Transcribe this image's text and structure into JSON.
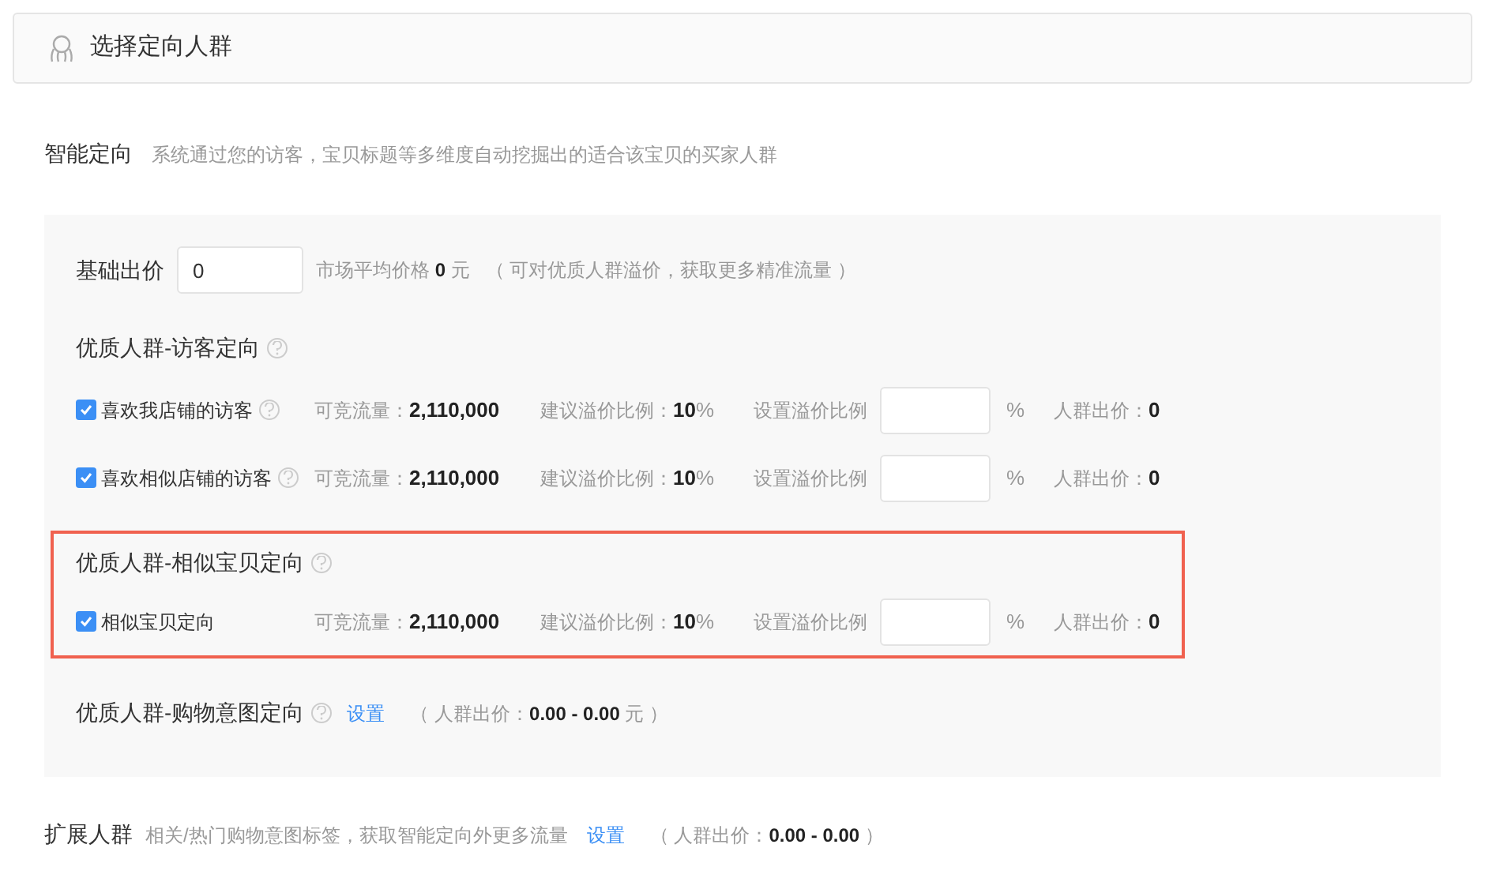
{
  "header": {
    "title": "选择定向人群"
  },
  "smart": {
    "title": "智能定向",
    "desc": "系统通过您的访客，宝贝标题等多维度自动挖掘出的适合该宝贝的买家人群"
  },
  "base_bid": {
    "label": "基础出价",
    "value": "0",
    "note": "市场平均价格 **0** 元",
    "hint": "（ 可对优质人群溢价，获取更多精准流量 ）"
  },
  "groups": [
    {
      "title": "优质人群-访客定向",
      "highlighted": false,
      "rows": [
        {
          "label": "喜欢我店铺的访客",
          "checked": true,
          "help": true,
          "traffic_label": "可竞流量：",
          "traffic": "2,110,000",
          "suggest_label": "建议溢价比例：",
          "suggest": "**10**%",
          "set_label": "设置溢价比例",
          "unit": "%",
          "bid_label": "人群出价：",
          "bid": "0"
        },
        {
          "label": "喜欢相似店铺的访客",
          "checked": true,
          "help": true,
          "traffic_label": "可竞流量：",
          "traffic": "2,110,000",
          "suggest_label": "建议溢价比例：",
          "suggest": "**10**%",
          "set_label": "设置溢价比例",
          "unit": "%",
          "bid_label": "人群出价：",
          "bid": "0"
        }
      ]
    },
    {
      "title": "优质人群-相似宝贝定向",
      "highlighted": true,
      "rows": [
        {
          "label": "相似宝贝定向",
          "checked": true,
          "help": false,
          "traffic_label": "可竞流量：",
          "traffic": "2,110,000",
          "suggest_label": "建议溢价比例：",
          "suggest": "**10**%",
          "set_label": "设置溢价比例",
          "unit": "%",
          "bid_label": "人群出价：",
          "bid": "0"
        }
      ]
    }
  ],
  "intent": {
    "title": "优质人群-购物意图定向",
    "link": "设置",
    "price": "（ 人群出价：**0.00 - 0.00** 元 ）"
  },
  "expand": {
    "title": "扩展人群",
    "desc": "相关/热门购物意图标签，获取智能定向外更多流量",
    "link": "设置",
    "price": "（ 人群出价：**0.00 - 0.00** ）"
  }
}
